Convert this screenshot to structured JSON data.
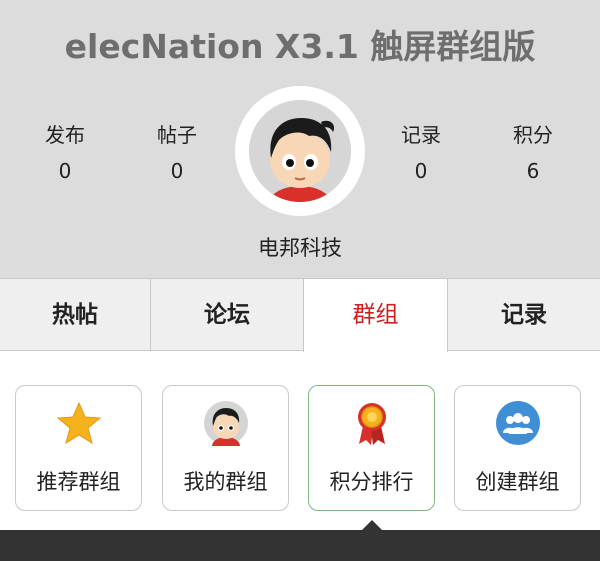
{
  "header": {
    "title": "elecNation X3.1 触屏群组版",
    "username": "电邦科技",
    "stats": [
      {
        "label": "发布",
        "value": "0"
      },
      {
        "label": "帖子",
        "value": "0"
      },
      {
        "label": "记录",
        "value": "0"
      },
      {
        "label": "积分",
        "value": "6"
      }
    ]
  },
  "tabs": [
    {
      "label": "热帖",
      "active": false
    },
    {
      "label": "论坛",
      "active": false
    },
    {
      "label": "群组",
      "active": true
    },
    {
      "label": "记录",
      "active": false
    }
  ],
  "cards": [
    {
      "label": "推荐群组",
      "icon": "star-icon"
    },
    {
      "label": "我的群组",
      "icon": "avatar-icon"
    },
    {
      "label": "积分排行",
      "icon": "medal-icon"
    },
    {
      "label": "创建群组",
      "icon": "people-icon"
    }
  ],
  "colors": {
    "active_tab": "#cc1f1f",
    "header_bg": "#dcdcdc",
    "active_card_border": "#7fb77f"
  }
}
